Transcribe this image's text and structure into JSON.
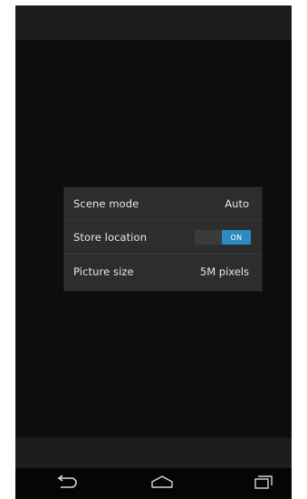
{
  "settings": {
    "rows": [
      {
        "label": "Scene mode",
        "value": "Auto"
      },
      {
        "label": "Store location",
        "toggle": "ON"
      },
      {
        "label": "Picture size",
        "value": "5M pixels"
      }
    ]
  },
  "icons": {
    "back": "back-icon",
    "home": "home-icon",
    "recent": "recent-apps-icon"
  },
  "colors": {
    "accent": "#2a8cc0",
    "panel": "#2d2d2d",
    "background": "#0d0d0d"
  }
}
